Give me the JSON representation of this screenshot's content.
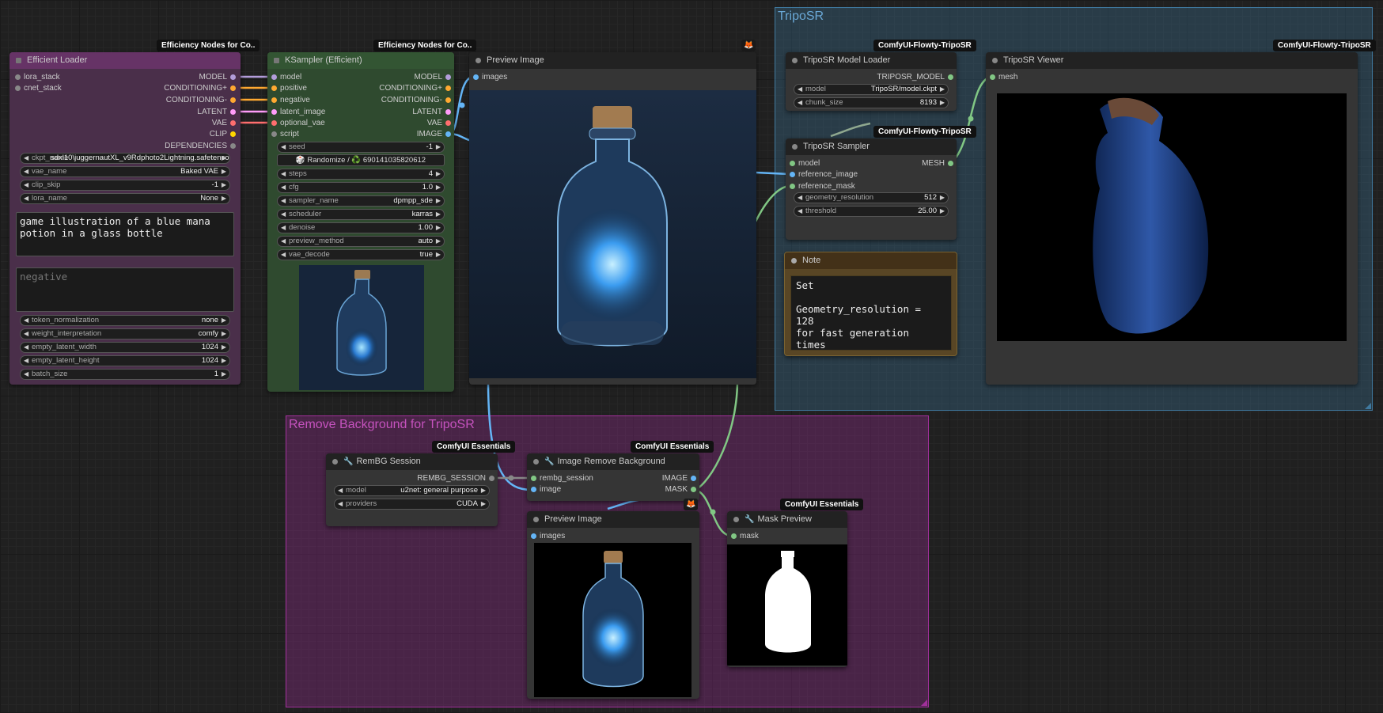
{
  "colors": {
    "model": "#b39ddb",
    "conditioning": "#ffa931",
    "latent": "#ff9cf9",
    "vae": "#ff6e6e",
    "clip": "#ffd500",
    "image": "#64b5f6",
    "mask": "#81c784",
    "generic": "#888888"
  },
  "groups": {
    "triposr": {
      "title": "TripoSR",
      "color": "#3f789e"
    },
    "rembg": {
      "title": "Remove Background for TripoSR",
      "color": "#a1309b"
    }
  },
  "nodes": {
    "efficient_loader": {
      "badge": "Efficiency Nodes for Co..",
      "title": "Efficient Loader",
      "inputs": [
        "lora_stack",
        "cnet_stack"
      ],
      "outputs": [
        "MODEL",
        "CONDITIONING+",
        "CONDITIONING-",
        "LATENT",
        "VAE",
        "CLIP",
        "DEPENDENCIES"
      ],
      "widgets": {
        "ckpt_name": {
          "label": "ckpt_name",
          "value": "sdxl10\\juggernautXL_v9Rdphoto2Lightning.safetensors"
        },
        "vae_name": {
          "label": "vae_name",
          "value": "Baked VAE"
        },
        "clip_skip": {
          "label": "clip_skip",
          "value": "-1"
        },
        "lora_name": {
          "label": "lora_name",
          "value": "None"
        },
        "token_normalization": {
          "label": "token_normalization",
          "value": "none"
        },
        "weight_interpretation": {
          "label": "weight_interpretation",
          "value": "comfy"
        },
        "empty_latent_width": {
          "label": "empty_latent_width",
          "value": "1024"
        },
        "empty_latent_height": {
          "label": "empty_latent_height",
          "value": "1024"
        },
        "batch_size": {
          "label": "batch_size",
          "value": "1"
        }
      },
      "positive_text": "game illustration of a blue mana potion in a glass bottle",
      "negative_placeholder": "negative"
    },
    "ksampler": {
      "badge": "Efficiency Nodes for Co..",
      "title": "KSampler (Efficient)",
      "inputs": [
        "model",
        "positive",
        "negative",
        "latent_image",
        "optional_vae",
        "script"
      ],
      "outputs": [
        "MODEL",
        "CONDITIONING+",
        "CONDITIONING-",
        "LATENT",
        "VAE",
        "IMAGE"
      ],
      "widgets": {
        "seed": {
          "label": "seed",
          "value": "-1"
        },
        "steps": {
          "label": "steps",
          "value": "4"
        },
        "cfg": {
          "label": "cfg",
          "value": "1.0"
        },
        "sampler_name": {
          "label": "sampler_name",
          "value": "dpmpp_sde"
        },
        "scheduler": {
          "label": "scheduler",
          "value": "karras"
        },
        "denoise": {
          "label": "denoise",
          "value": "1.00"
        },
        "preview_method": {
          "label": "preview_method",
          "value": "auto"
        },
        "vae_decode": {
          "label": "vae_decode",
          "value": "true"
        }
      },
      "seed_button": "🎲 Randomize / ♻️ 690141035820612"
    },
    "preview_main": {
      "badge": "🦊",
      "title": "Preview Image",
      "input": "images"
    },
    "triposr_loader": {
      "badge": "ComfyUI-Flowty-TripoSR",
      "title": "TripoSR Model Loader",
      "output": "TRIPOSR_MODEL",
      "widgets": {
        "model": {
          "label": "model",
          "value": "TripoSR/model.ckpt"
        },
        "chunk_size": {
          "label": "chunk_size",
          "value": "8193"
        }
      }
    },
    "triposr_sampler": {
      "badge": "ComfyUI-Flowty-TripoSR",
      "title": "TripoSR Sampler",
      "inputs": [
        "model",
        "reference_image",
        "reference_mask"
      ],
      "output": "MESH",
      "widgets": {
        "geometry_resolution": {
          "label": "geometry_resolution",
          "value": "512"
        },
        "threshold": {
          "label": "threshold",
          "value": "25.00"
        }
      }
    },
    "triposr_viewer": {
      "badge": "ComfyUI-Flowty-TripoSR",
      "title": "TripoSR Viewer",
      "input": "mesh"
    },
    "note": {
      "title": "Note",
      "text": "Set\n\nGeometry_resolution =\n128\nfor fast generation\ntimes"
    },
    "rembg_session": {
      "badge": "ComfyUI Essentials",
      "title": "RemBG Session",
      "output": "REMBG_SESSION",
      "widgets": {
        "model": {
          "label": "model",
          "value": "u2net: general purpose"
        },
        "providers": {
          "label": "providers",
          "value": "CUDA"
        }
      }
    },
    "image_remove_bg": {
      "badge": "ComfyUI Essentials",
      "title": "Image Remove Background",
      "inputs": [
        "rembg_session",
        "image"
      ],
      "outputs": [
        "IMAGE",
        "MASK"
      ]
    },
    "preview_small": {
      "badge": "🦊",
      "title": "Preview Image",
      "input": "images"
    },
    "mask_preview": {
      "badge": "ComfyUI Essentials",
      "title": "Mask Preview",
      "input": "mask"
    }
  }
}
